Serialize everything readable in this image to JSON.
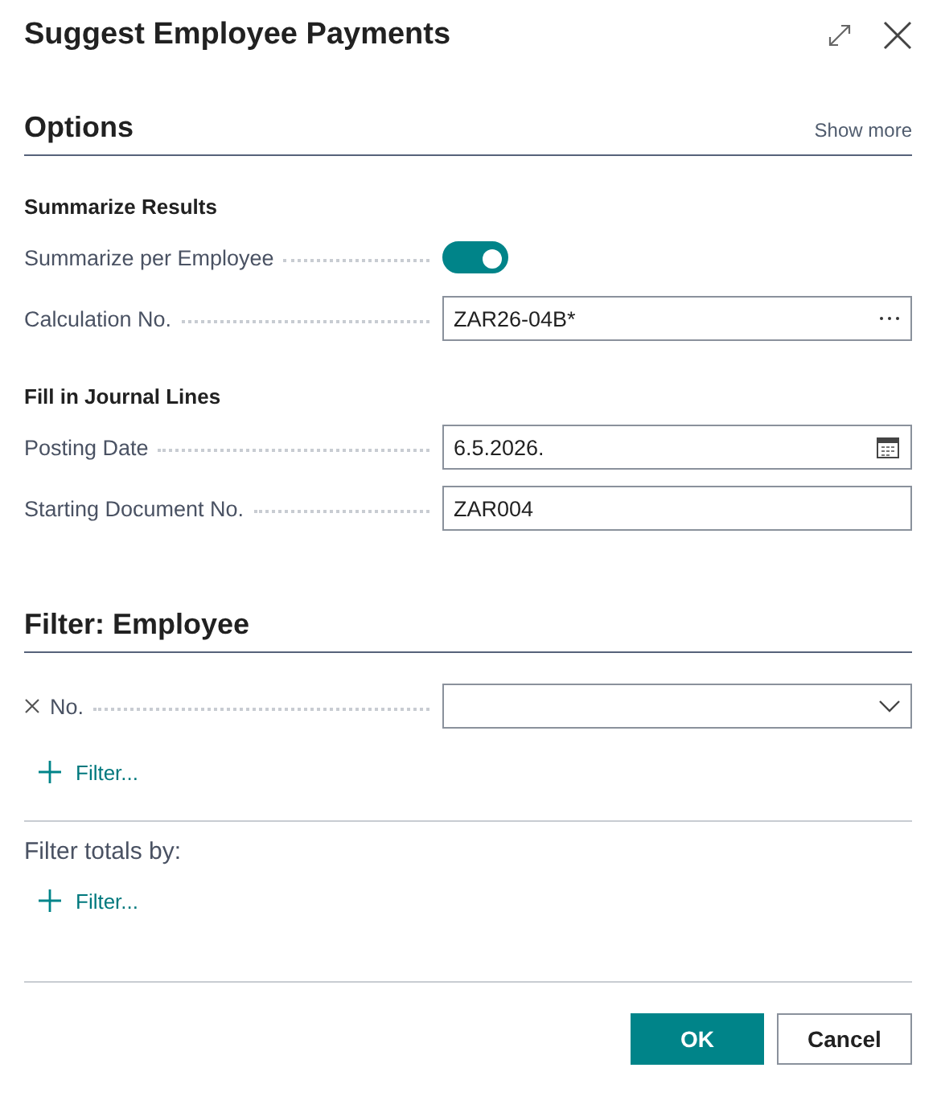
{
  "dialog": {
    "title": "Suggest Employee Payments"
  },
  "options": {
    "title": "Options",
    "show_more": "Show more",
    "groups": [
      {
        "heading": "Summarize Results",
        "fields": [
          {
            "kind": "toggle",
            "label": "Summarize per Employee",
            "on": true
          },
          {
            "kind": "lookup",
            "label": "Calculation No.",
            "value": "ZAR26-04B*"
          }
        ]
      },
      {
        "heading": "Fill in Journal Lines",
        "fields": [
          {
            "kind": "date",
            "label": "Posting Date",
            "value": "6.5.2026."
          },
          {
            "kind": "text",
            "label": "Starting Document No.",
            "value": "ZAR004"
          }
        ]
      }
    ]
  },
  "filter": {
    "title": "Filter: Employee",
    "fields": [
      {
        "kind": "dropdown",
        "label": "No.",
        "removable": true
      }
    ],
    "add_filter": "Filter...",
    "totals_label": "Filter totals by:",
    "totals_add_filter": "Filter..."
  },
  "buttons": [
    {
      "label": "OK",
      "primary": true
    },
    {
      "label": "Cancel",
      "primary": false
    }
  ]
}
